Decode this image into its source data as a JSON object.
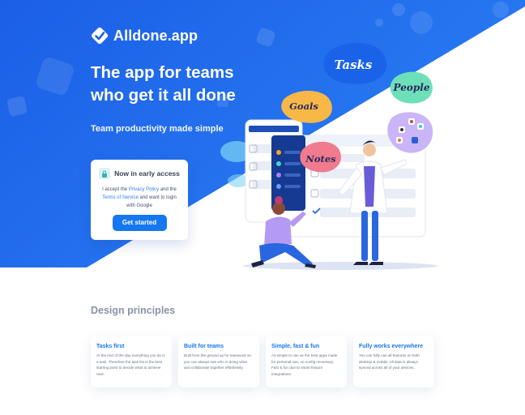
{
  "brand": {
    "name": "Alldone.app"
  },
  "hero": {
    "headline_line1": "The app for teams",
    "headline_line2": "who get it all done",
    "subheadline": "Team productivity made simple"
  },
  "access_card": {
    "title": "Now in early access",
    "text_before": "I accept the ",
    "privacy_link": "Privacy Policy",
    "text_mid1": " and the ",
    "terms_link": "Terms of Service",
    "text_after": " and want to login with Google",
    "button_label": "Get started"
  },
  "illustration": {
    "bubbles": [
      "Tasks",
      "People",
      "Goals",
      "Notes"
    ]
  },
  "principles": {
    "title": "Design principles",
    "cards": [
      {
        "title": "Tasks first",
        "text": "At the end of the day everything you do is a task. Therefore the task list is the best starting point to decide what to achieve next."
      },
      {
        "title": "Built for teams",
        "text": "Built from the ground up for teamwork so you can always see who is doing what and collaborate  together effortlessly."
      },
      {
        "title": "Simple, fast & fun",
        "text": "As simple to use as the best apps made for personal use, no config necessary. Fast & fun due to smart feature integrations."
      },
      {
        "title": "Fully works everywhere",
        "text": "You can fully use all features on both desktop & mobile. All data is always synced across all of your devices."
      }
    ]
  },
  "colors": {
    "hero_blue": "#1a63e8",
    "accent": "#1677f0",
    "white": "#ffffff"
  }
}
